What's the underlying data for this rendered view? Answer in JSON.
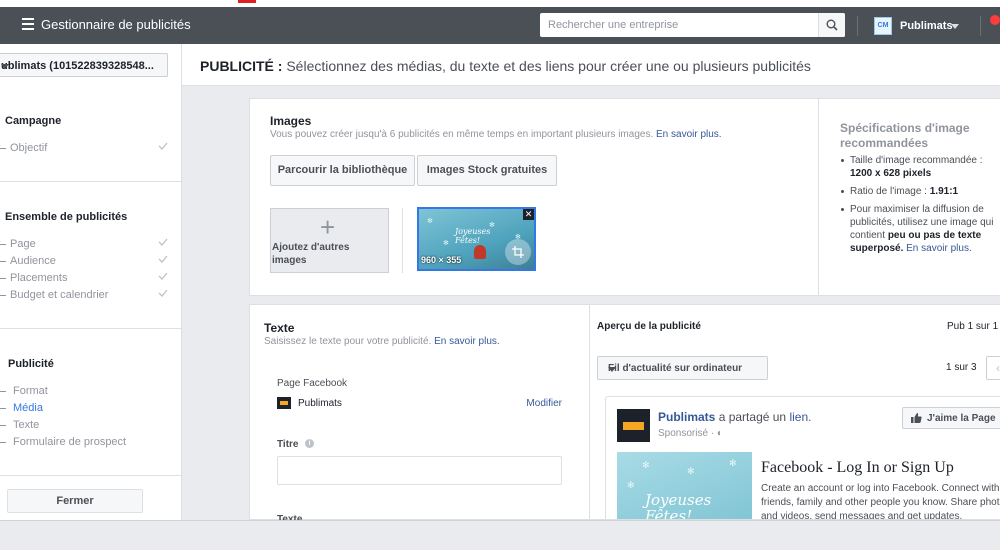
{
  "topbar": {
    "app_title": "Gestionnaire de publicités",
    "search_placeholder": "Rechercher une entreprise",
    "account_initials": "CM",
    "account_name": "Publimats"
  },
  "sidebar": {
    "account_selector": "ublimats (101522839328548...",
    "sections": [
      {
        "heading": "Campagne",
        "items": [
          {
            "label": "Objectif",
            "done": true
          }
        ]
      },
      {
        "heading": "Ensemble de publicités",
        "items": [
          {
            "label": "Page",
            "done": true
          },
          {
            "label": "Audience",
            "done": true
          },
          {
            "label": "Placements",
            "done": true
          },
          {
            "label": "Budget et calendrier",
            "done": true
          }
        ]
      },
      {
        "heading": "Publicité",
        "items": [
          {
            "label": "Format",
            "done": false
          },
          {
            "label": "Média",
            "done": false,
            "active": true
          },
          {
            "label": "Texte",
            "done": false
          },
          {
            "label": "Formulaire de prospect",
            "done": false
          }
        ]
      }
    ],
    "close_label": "Fermer"
  },
  "header": {
    "title_bold": "PUBLICITÉ :",
    "title_rest": "Sélectionnez des médias, du texte et des liens pour créer une ou plusieurs publicités"
  },
  "images": {
    "heading": "Images",
    "subtitle": "Vous pouvez créer jusqu'à 6 publicités en même temps en important plusieurs images.",
    "learn_more": "En savoir plus.",
    "browse_label": "Parcourir la bibliothèque",
    "stock_label": "Images Stock gratuites",
    "add_label_1": "Ajoutez d'autres",
    "add_label_2": "images",
    "thumb_dims": "960 × 355",
    "thumb_caption_1": "Joyeuses",
    "thumb_caption_2": "Fêtes!"
  },
  "specs": {
    "heading": "Spécifications d'image recommandées",
    "size_label": "Taille d'image recommandée :",
    "size_value": "1200 x 628 pixels",
    "ratio_label": "Ratio de l'image :",
    "ratio_value": "1.91:1",
    "tip_1": "Pour maximiser la diffusion de publicités, utilisez une image qui contient",
    "tip_bold": "peu ou pas de texte superposé.",
    "tip_link": "En savoir plus."
  },
  "text_section": {
    "heading": "Texte",
    "subtitle": "Saisissez le texte pour votre publicité.",
    "learn_more": "En savoir plus.",
    "page_label": "Page Facebook",
    "page_name": "Publimats",
    "modify": "Modifier",
    "title_label": "Titre",
    "title_value": "",
    "text_label": "Texte"
  },
  "preview": {
    "heading": "Aperçu de la publicité",
    "pub_count": "Pub 1 sur 1",
    "placement": "Fil d'actualité sur ordinateur",
    "page_count": "1 sur 3",
    "post_page": "Publimats",
    "post_action": "a partagé un",
    "post_link": "lien.",
    "sponsored": "Sponsorisé ·",
    "like_label": "J'aime la Page",
    "link_title": "Facebook - Log In or Sign Up",
    "link_desc": "Create an account or log into Facebook. Connect with friends, family and other people you know. Share photos and videos, send messages and get updates.",
    "image_caption_1": "Joyeuses",
    "image_caption_2": "Fêtes!"
  },
  "colors": {
    "topbar": "#4b4f56",
    "link": "#365899",
    "accent": "#3578e5"
  }
}
